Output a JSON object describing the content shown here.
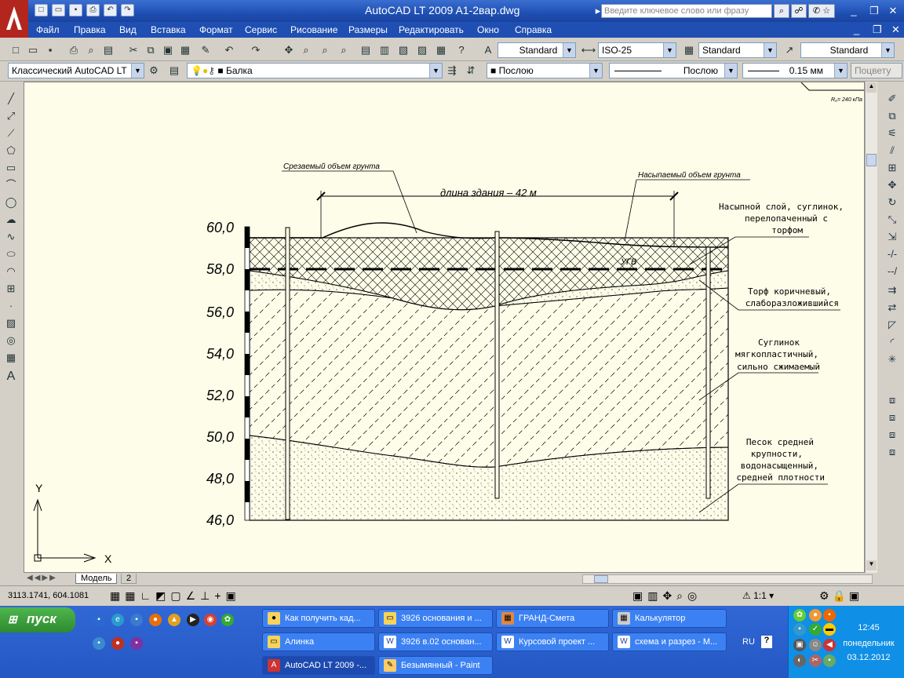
{
  "app": {
    "title": "AutoCAD LT 2009",
    "file": "A1-2вар.dwg",
    "search_placeholder": "Введите ключевое слово или фразу"
  },
  "menu": [
    "Файл",
    "Правка",
    "Вид",
    "Вставка",
    "Формат",
    "Сервис",
    "Рисование",
    "Размеры",
    "Редактировать",
    "Окно",
    "Справка"
  ],
  "toolbar": {
    "text_style": "Standard",
    "dim_style": "ISO-25",
    "table_style": "Standard",
    "mleader_style": "Standard",
    "workspace": "Классический AutoCAD LT",
    "layer": "Балка",
    "color": "Послою",
    "linetype": "Послою",
    "lineweight": "0.15 мм",
    "plotstyle": "Поцвету"
  },
  "drawing": {
    "cut_label": "Срезаемый объем грунта",
    "fill_label": "Насыпаемый объем грунта",
    "length_label": "длина здания – 42 м",
    "ugv": "УГВ",
    "corner_text": "R₀= 240 кПа",
    "elevations": [
      "60,0",
      "58,0",
      "56,0",
      "54,0",
      "52,0",
      "50,0",
      "48,0",
      "46,0"
    ],
    "layers": [
      [
        "Насыпной слой, суглинок,",
        "перелопаченный с",
        "торфом"
      ],
      [
        "Торф коричневый,",
        "слаборазложившийся"
      ],
      [
        "Суглинок",
        "мягкопластичный,",
        "сильно сжимаемый"
      ],
      [
        "Песок средней",
        "крупности,",
        "водонасыщенный,",
        "средней плотности"
      ]
    ],
    "ucs_x": "X",
    "ucs_y": "Y"
  },
  "tabs": {
    "model": "Модель",
    "layout": "2"
  },
  "status": {
    "coords": "3113.1741, 604.1081",
    "scale": "1:1"
  },
  "taskbar": {
    "start": "пуск",
    "tasks": [
      "Как получить кад...",
      "3926 основания и ...",
      "ГРАНД-Смета",
      "Калькулятор",
      "Алинка",
      "3926 в.02 основан...",
      "Курсовой проект ...",
      "схема и разрез - M...",
      "AutoCAD LT 2009 -...",
      "Безымянный - Paint"
    ],
    "lang": "RU",
    "time": "12:45",
    "day": "понедельник",
    "date": "03.12.2012"
  }
}
